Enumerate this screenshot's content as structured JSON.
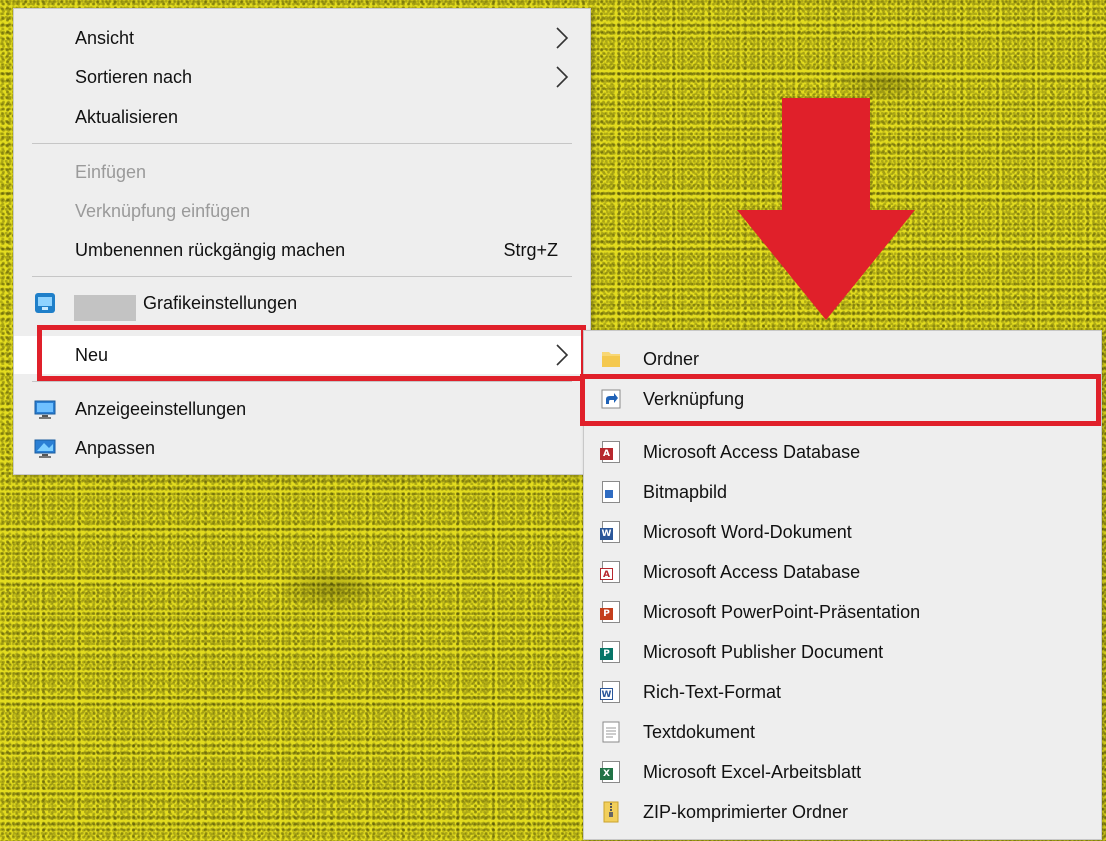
{
  "main_menu": {
    "items": [
      {
        "label": "Ansicht"
      },
      {
        "label": "Sortieren nach"
      },
      {
        "label": "Aktualisieren"
      },
      {
        "label": "Einfügen"
      },
      {
        "label": "Verknüpfung einfügen"
      },
      {
        "label": "Umbenennen rückgängig machen",
        "shortcut": "Strg+Z"
      },
      {
        "label": "Grafikeinstellungen"
      },
      {
        "label": "Neu"
      },
      {
        "label": "Anzeigeeinstellungen"
      },
      {
        "label": "Anpassen"
      }
    ]
  },
  "new_submenu": {
    "items": [
      {
        "label": "Ordner",
        "icon": "folder-icon"
      },
      {
        "label": "Verknüpfung",
        "icon": "shortcut-icon"
      },
      {
        "label": "Microsoft Access Database",
        "icon": "access-icon"
      },
      {
        "label": "Bitmapbild",
        "icon": "bitmap-icon"
      },
      {
        "label": "Microsoft Word-Dokument",
        "icon": "word-icon"
      },
      {
        "label": "Microsoft Access Database",
        "icon": "access-icon"
      },
      {
        "label": "Microsoft PowerPoint-Präsentation",
        "icon": "powerpoint-icon"
      },
      {
        "label": "Microsoft Publisher Document",
        "icon": "publisher-icon"
      },
      {
        "label": "Rich-Text-Format",
        "icon": "word-icon"
      },
      {
        "label": "Textdokument",
        "icon": "text-document-icon"
      },
      {
        "label": "Microsoft Excel-Arbeitsblatt",
        "icon": "excel-icon"
      },
      {
        "label": "ZIP-komprimierter Ordner",
        "icon": "zip-folder-icon"
      }
    ]
  },
  "colors": {
    "highlight": "#e0202a",
    "arrow": "#e0202a",
    "menu_bg": "#eeeeee",
    "disabled_text": "#9a9a9a",
    "desktop": "#e3dc1f"
  }
}
